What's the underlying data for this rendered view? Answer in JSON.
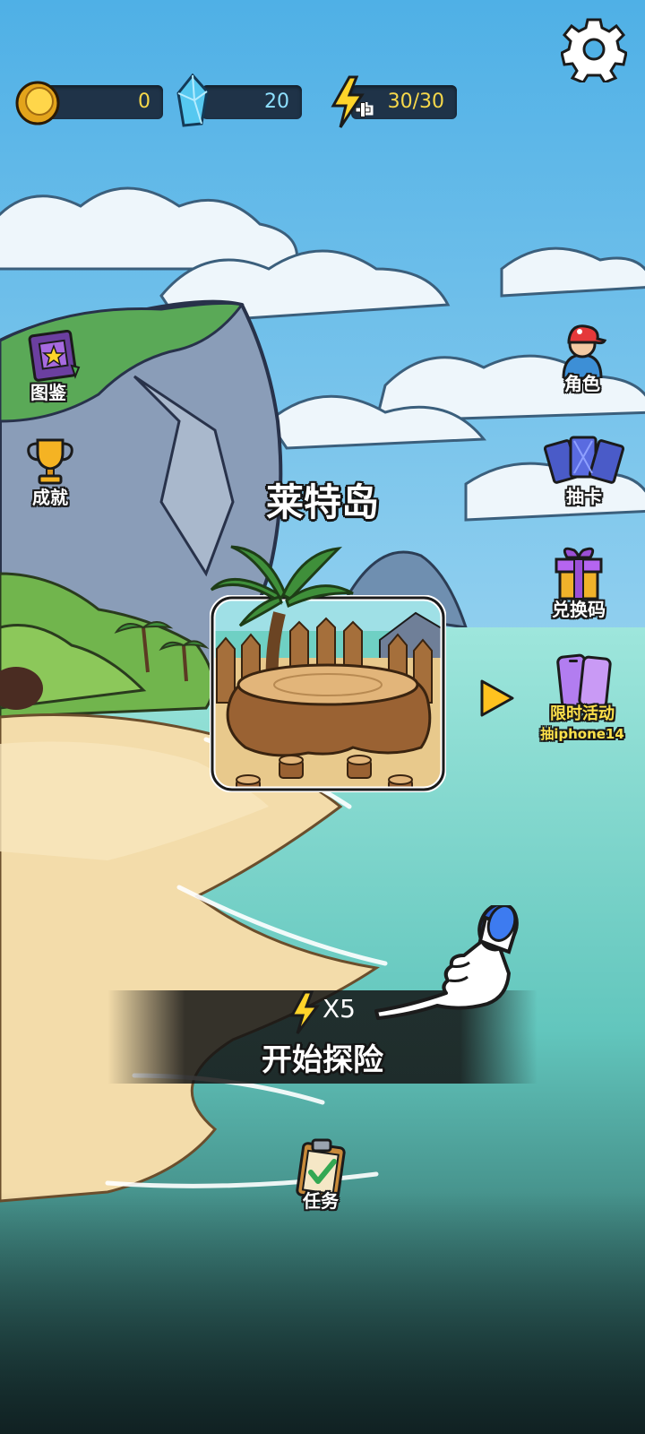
{
  "resources": {
    "coins": "0",
    "gems": "20",
    "energy": "30/30"
  },
  "left_menu": {
    "codex_label": "图鉴",
    "achievements_label": "成就"
  },
  "right_menu": {
    "character_label": "角色",
    "draw_card_label": "抽卡",
    "redeem_code_label": "兑换码",
    "event_label": "限时活动",
    "event_sub_label": "抽iphone14"
  },
  "stage": {
    "island_name": "莱特岛"
  },
  "start": {
    "cost_label": "X5",
    "button_label": "开始探险"
  },
  "bottom": {
    "tasks_label": "任务"
  },
  "colors": {
    "sky": "#7cc4ea",
    "sea": "#6fd0c4",
    "sand": "#f0d9a6",
    "coin_text": "#f7d84a",
    "gem_text": "#8ee0ff",
    "event_text": "#ffe14a"
  },
  "icons": {
    "settings": "gear-icon",
    "coin": "coin-icon",
    "gem": "crystal-icon",
    "energy": "lightning-plus-icon",
    "codex": "book-icon",
    "achievements": "trophy-icon",
    "character": "character-cap-icon",
    "draw_card": "cards-icon",
    "redeem": "gift-box-icon",
    "event": "phone-icon",
    "next": "arrow-right-icon",
    "tasks": "clipboard-check-icon",
    "tutorial_hand": "pointing-hand-icon"
  }
}
